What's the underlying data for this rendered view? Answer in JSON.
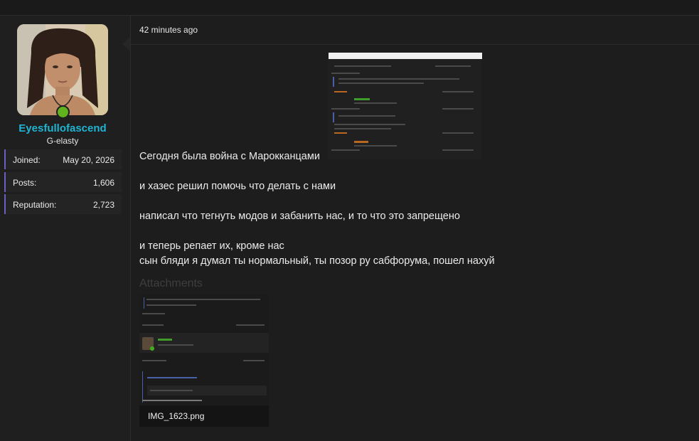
{
  "user": {
    "username": "Eyesfullofascend",
    "title": "G-elasty",
    "stats": [
      {
        "label": "Joined:",
        "value": "May 20, 2026"
      },
      {
        "label": "Posts:",
        "value": "1,606"
      },
      {
        "label": "Reputation:",
        "value": "2,723"
      }
    ],
    "status": "online",
    "colors": {
      "username": "#1fb4d2",
      "online": "#62b11f",
      "stat_accent": "#6b5fc2"
    }
  },
  "post": {
    "timestamp": "42 minutes ago",
    "paragraphs": [
      "Сегодня была война с Марокканцами",
      "и хазес решил помочь что делать с нами",
      "написал что тегнуть модов и забанить нас, и то что это запрещено",
      "и теперь репает их, кроме нас",
      "сын бляди я думал ты нормальный, ты позор ру сабфорума, пошел нахуй"
    ],
    "attachments_label": "Attachments",
    "attachment": {
      "filename": "IMG_1623.png"
    }
  }
}
